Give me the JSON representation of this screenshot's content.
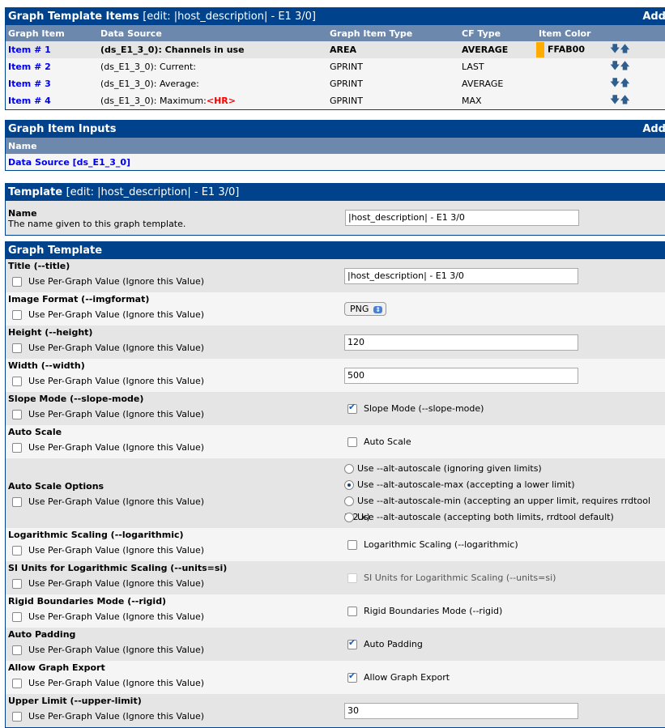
{
  "items": {
    "title": "Graph Template Items",
    "edit": "[edit: |host_description| - E1 3/0]",
    "add": "Add",
    "columns": [
      "Graph Item",
      "Data Source",
      "Graph Item Type",
      "CF Type",
      "Item Color"
    ],
    "rows": [
      {
        "item": "Item # 1",
        "source": "(ds_E1_3_0): Channels in use",
        "extra": "",
        "type": "AREA",
        "cf": "AVERAGE",
        "color": "FFAB00",
        "swatch": "#FFAB00"
      },
      {
        "item": "Item # 2",
        "source": "(ds_E1_3_0): Current:",
        "extra": "",
        "type": "GPRINT",
        "cf": "LAST",
        "color": ""
      },
      {
        "item": "Item # 3",
        "source": "(ds_E1_3_0): Average:",
        "extra": "",
        "type": "GPRINT",
        "cf": "AVERAGE",
        "color": ""
      },
      {
        "item": "Item # 4",
        "source": "(ds_E1_3_0): Maximum:",
        "extra": "<HR>",
        "type": "GPRINT",
        "cf": "MAX",
        "color": ""
      }
    ]
  },
  "inputs": {
    "title": "Graph Item Inputs",
    "add": "Add",
    "column": "Name",
    "row": "Data Source [ds_E1_3_0]"
  },
  "template": {
    "title": "Template",
    "edit": "[edit: |host_description| - E1 3/0]",
    "name_label": "Name",
    "name_desc": "The name given to this graph template.",
    "name_value": "|host_description| - E1 3/0"
  },
  "graph": {
    "title": "Graph Template",
    "per_graph": "Use Per-Graph Value (Ignore this Value)",
    "fields": {
      "title": {
        "label": "Title (--title)",
        "value": "|host_description| - E1 3/0"
      },
      "imgformat": {
        "label": "Image Format (--imgformat)",
        "value": "PNG"
      },
      "height": {
        "label": "Height (--height)",
        "value": "120"
      },
      "width": {
        "label": "Width (--width)",
        "value": "500"
      },
      "slope": {
        "label": "Slope Mode (--slope-mode)",
        "check": "Slope Mode (--slope-mode)",
        "checked": true
      },
      "autoscale": {
        "label": "Auto Scale",
        "check": "Auto Scale",
        "checked": false
      },
      "autoscale_opts": {
        "label": "Auto Scale Options",
        "options": [
          "Use --alt-autoscale (ignoring given limits)",
          "Use --alt-autoscale-max (accepting a lower limit)",
          "Use --alt-autoscale-min (accepting an upper limit, requires rrdtool 1.2.x)",
          "Use --alt-autoscale (accepting both limits, rrdtool default)"
        ],
        "selected": 1
      },
      "log": {
        "label": "Logarithmic Scaling (--logarithmic)",
        "check": "Logarithmic Scaling (--logarithmic)",
        "checked": false
      },
      "si": {
        "label": "SI Units for Logarithmic Scaling (--units=si)",
        "check": "SI Units for Logarithmic Scaling (--units=si)",
        "checked": false,
        "disabled": true
      },
      "rigid": {
        "label": "Rigid Boundaries Mode (--rigid)",
        "check": "Rigid Boundaries Mode (--rigid)",
        "checked": false
      },
      "padding": {
        "label": "Auto Padding",
        "check": "Auto Padding",
        "checked": true
      },
      "export": {
        "label": "Allow Graph Export",
        "check": "Allow Graph Export",
        "checked": true
      },
      "upper": {
        "label": "Upper Limit (--upper-limit)",
        "value": "30"
      }
    }
  }
}
